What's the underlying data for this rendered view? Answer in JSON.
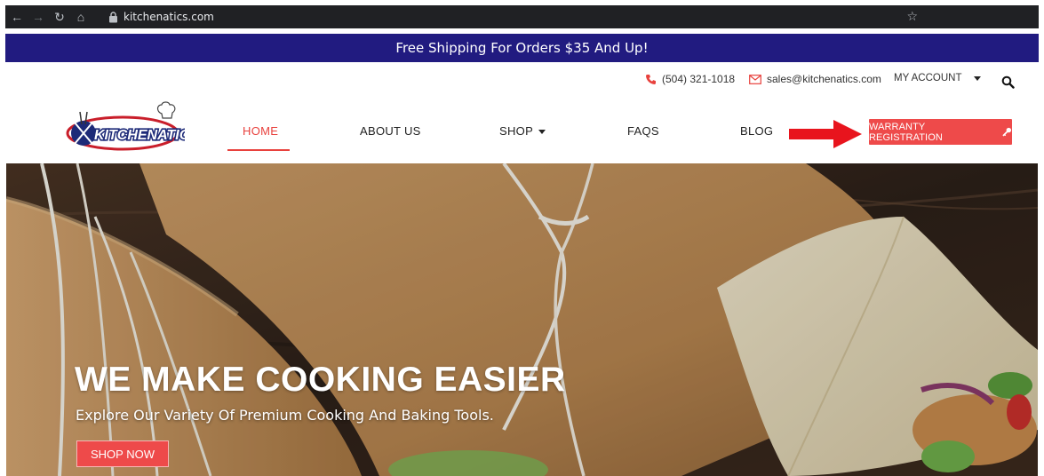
{
  "browser": {
    "url": "kitchenatics.com"
  },
  "promo": {
    "text": "Free Shipping For Orders $35 And Up!"
  },
  "contact": {
    "phone": "(504) 321-1018",
    "email": "sales@kitchenatics.com",
    "account_label": "MY ACCOUNT"
  },
  "nav": {
    "items": [
      {
        "label": "HOME",
        "active": true
      },
      {
        "label": "ABOUT US"
      },
      {
        "label": "SHOP"
      },
      {
        "label": "FAQS"
      },
      {
        "label": "BLOG"
      }
    ],
    "warranty_label": "WARRANTY REGISTRATION"
  },
  "hero": {
    "title": "WE MAKE COOKING EASIER",
    "subtitle": "Explore Our Variety Of Premium Cooking And Baking Tools.",
    "cta_label": "SHOP NOW"
  },
  "logo": {
    "text": "KITCHENATICS"
  },
  "colors": {
    "accent": "#ee4a4a",
    "promo_bg": "#211b80",
    "browser_bg": "#202124"
  }
}
